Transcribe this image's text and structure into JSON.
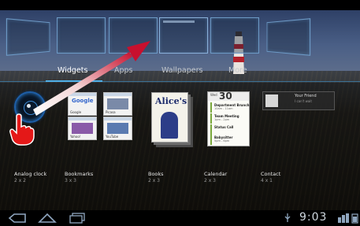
{
  "tabs": [
    {
      "label": "Widgets",
      "active": true
    },
    {
      "label": "Apps",
      "active": false
    },
    {
      "label": "Wallpapers",
      "active": false
    },
    {
      "label": "More",
      "active": false
    }
  ],
  "widgets": [
    {
      "name": "Analog clock",
      "size": "2 x 2"
    },
    {
      "name": "Bookmarks",
      "size": "3 x 3"
    },
    {
      "name": "Books",
      "size": "2 x 3"
    },
    {
      "name": "Calendar",
      "size": "2 x 3"
    },
    {
      "name": "Contact",
      "size": "4 x 1"
    }
  ],
  "bookmarks_preview": {
    "google": "Google",
    "captions": [
      "Google",
      "Picasa",
      "Yahoo!",
      "YouTube"
    ]
  },
  "books_preview": {
    "title": "Alice's"
  },
  "calendar_preview": {
    "day": "Wed",
    "date": "30",
    "events": [
      {
        "title": "Department Brunch",
        "sub": "10am - 11am"
      },
      {
        "title": "Team Meeting",
        "sub": "1pm - 2pm"
      },
      {
        "title": "Status Call",
        "sub": ""
      },
      {
        "title": "Babysitter",
        "sub": "5pm - 6pm"
      }
    ]
  },
  "contact_preview": {
    "name": "Your Friend",
    "status": "I can't wait"
  },
  "status_bar": {
    "time": "9:03"
  },
  "colors": {
    "accent": "#4fb0e8",
    "arrow": "#c8102e"
  }
}
